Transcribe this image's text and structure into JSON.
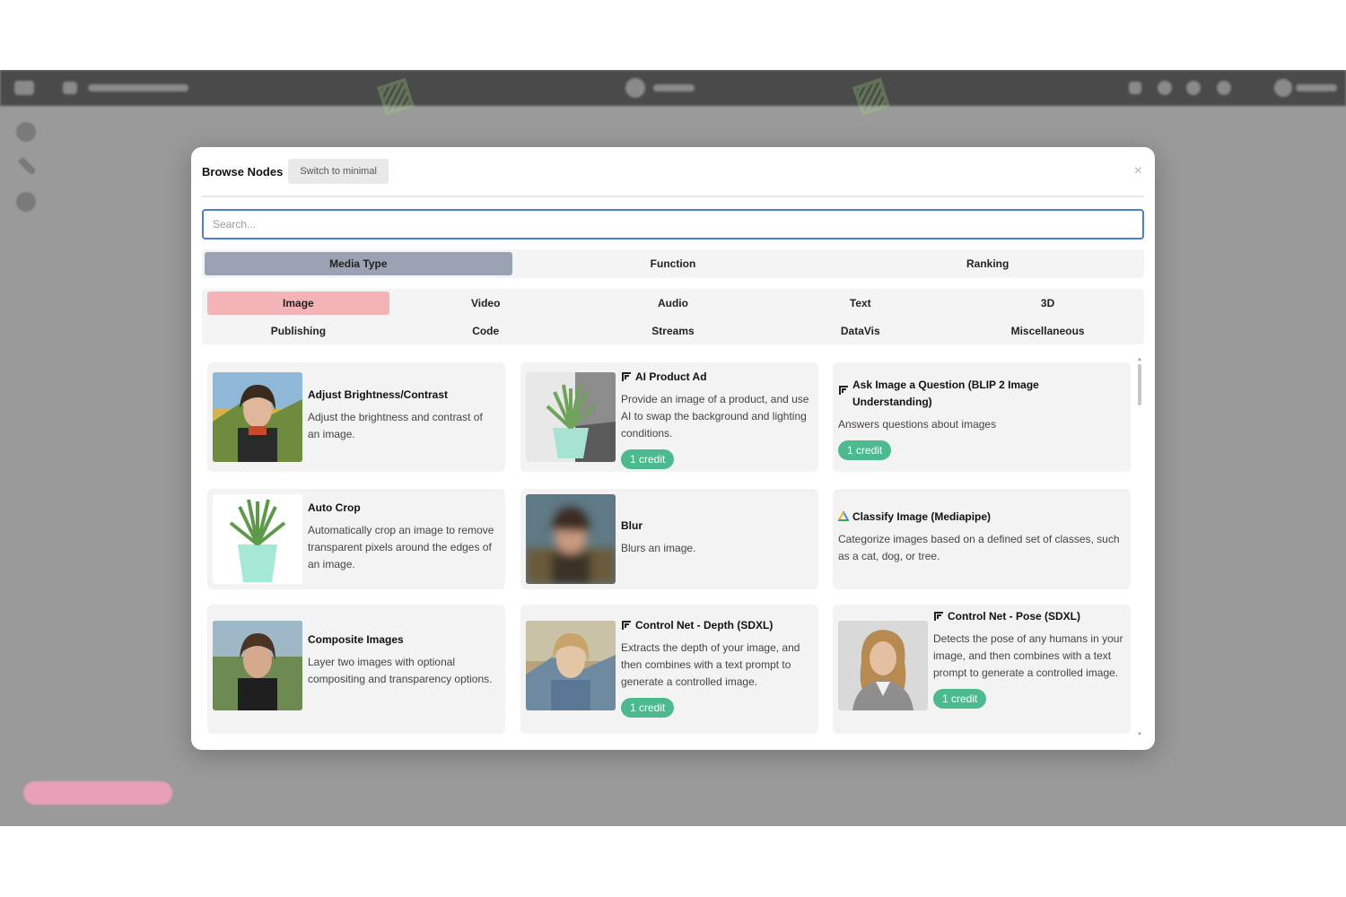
{
  "modal": {
    "title": "Browse Nodes",
    "switch_label": "Switch to minimal",
    "close_icon": "×",
    "search_placeholder": "Search..."
  },
  "tabs": [
    {
      "label": "Media Type",
      "active": true
    },
    {
      "label": "Function",
      "active": false
    },
    {
      "label": "Ranking",
      "active": false
    }
  ],
  "categories": [
    {
      "label": "Image",
      "active": true
    },
    {
      "label": "Video",
      "active": false
    },
    {
      "label": "Audio",
      "active": false
    },
    {
      "label": "Text",
      "active": false
    },
    {
      "label": "3D",
      "active": false
    },
    {
      "label": "Publishing",
      "active": false
    },
    {
      "label": "Code",
      "active": false
    },
    {
      "label": "Streams",
      "active": false
    },
    {
      "label": "DataVis",
      "active": false
    },
    {
      "label": "Miscellaneous",
      "active": false
    }
  ],
  "nodes": [
    {
      "title": "Adjust Brightness/Contrast",
      "description": "Adjust the brightness and contrast of an image.",
      "thumb": "portrait",
      "icon": null,
      "badge": null
    },
    {
      "title": "AI Product Ad",
      "description": "Provide an image of a product, and use AI to swap the background and lighting conditions.",
      "thumb": "plant",
      "icon": "comfy-icon",
      "badge": "1 credit"
    },
    {
      "title": "Ask Image a Question (BLIP 2 Image Understanding)",
      "description": "Answers questions about images",
      "thumb": null,
      "icon": "comfy-icon",
      "badge": "1 credit"
    },
    {
      "title": "Auto Crop",
      "description": "Automatically crop an image to remove transparent pixels around the edges of an image.",
      "thumb": "plant-clean",
      "icon": null,
      "badge": null
    },
    {
      "title": "Blur",
      "description": "Blurs an image.",
      "thumb": "blurred",
      "icon": null,
      "badge": null
    },
    {
      "title": "Classify Image (Mediapipe)",
      "description": "Categorize images based on a defined set of classes, such as a cat, dog, or tree.",
      "thumb": null,
      "icon": "google-icon",
      "badge": null
    },
    {
      "title": "Composite Images",
      "description": "Layer two images with optional compositing and transparency options.",
      "thumb": "portrait",
      "icon": null,
      "badge": null
    },
    {
      "title": "Control Net - Depth (SDXL)",
      "description": "Extracts the depth of your image, and then combines with a text prompt to generate a controlled image.",
      "thumb": "portrait-painted",
      "icon": "comfy-icon",
      "badge": "1 credit"
    },
    {
      "title": "Control Net - Pose (SDXL)",
      "description": "Detects the pose of any humans in your image, and then combines with a text prompt to generate a controlled image.",
      "thumb": "portrait-studio",
      "icon": "comfy-icon",
      "badge": "1 credit"
    }
  ],
  "colors": {
    "active_tab": "#9aa2b3",
    "active_category": "#f4b3b6",
    "credit_badge": "#4db98f",
    "search_border": "#4a7ed1"
  }
}
